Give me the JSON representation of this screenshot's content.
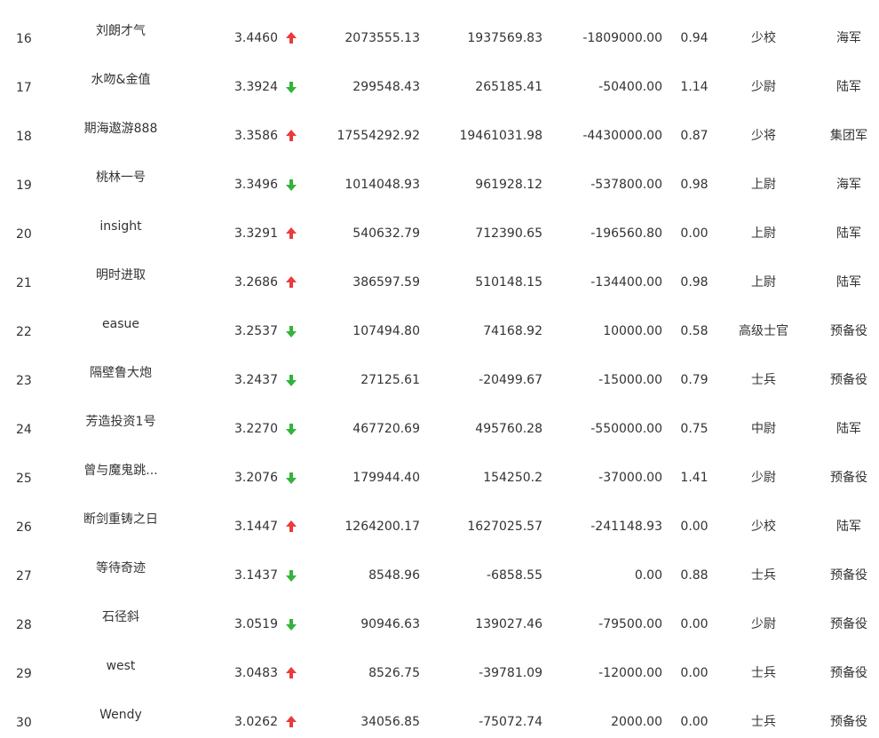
{
  "colors": {
    "up": "#ea3b3b",
    "down": "#33b33a",
    "text": "#333333"
  },
  "rows": [
    {
      "rank": "16",
      "name": "刘朗才气",
      "score": "3.4460",
      "trend": "up",
      "v1": "2073555.13",
      "v2": "1937569.83",
      "v3": "-1809000.00",
      "ratio": "0.94",
      "military_rank": "少校",
      "branch": "海军"
    },
    {
      "rank": "17",
      "name": "水吻&金值",
      "score": "3.3924",
      "trend": "down",
      "v1": "299548.43",
      "v2": "265185.41",
      "v3": "-50400.00",
      "ratio": "1.14",
      "military_rank": "少尉",
      "branch": "陆军"
    },
    {
      "rank": "18",
      "name": "期海遨游888",
      "score": "3.3586",
      "trend": "up",
      "v1": "17554292.92",
      "v2": "19461031.98",
      "v3": "-4430000.00",
      "ratio": "0.87",
      "military_rank": "少将",
      "branch": "集团军"
    },
    {
      "rank": "19",
      "name": "桃林一号",
      "score": "3.3496",
      "trend": "down",
      "v1": "1014048.93",
      "v2": "961928.12",
      "v3": "-537800.00",
      "ratio": "0.98",
      "military_rank": "上尉",
      "branch": "海军"
    },
    {
      "rank": "20",
      "name": "insight",
      "score": "3.3291",
      "trend": "up",
      "v1": "540632.79",
      "v2": "712390.65",
      "v3": "-196560.80",
      "ratio": "0.00",
      "military_rank": "上尉",
      "branch": "陆军"
    },
    {
      "rank": "21",
      "name": "明时进取",
      "score": "3.2686",
      "trend": "up",
      "v1": "386597.59",
      "v2": "510148.15",
      "v3": "-134400.00",
      "ratio": "0.98",
      "military_rank": "上尉",
      "branch": "陆军"
    },
    {
      "rank": "22",
      "name": "easue",
      "score": "3.2537",
      "trend": "down",
      "v1": "107494.80",
      "v2": "74168.92",
      "v3": "10000.00",
      "ratio": "0.58",
      "military_rank": "高级士官",
      "branch": "预备役"
    },
    {
      "rank": "23",
      "name": "隔壁鲁大炮",
      "score": "3.2437",
      "trend": "down",
      "v1": "27125.61",
      "v2": "-20499.67",
      "v3": "-15000.00",
      "ratio": "0.79",
      "military_rank": "士兵",
      "branch": "预备役"
    },
    {
      "rank": "24",
      "name": "芳造投资1号",
      "score": "3.2270",
      "trend": "down",
      "v1": "467720.69",
      "v2": "495760.28",
      "v3": "-550000.00",
      "ratio": "0.75",
      "military_rank": "中尉",
      "branch": "陆军"
    },
    {
      "rank": "25",
      "name": "曾与魔鬼跳...",
      "score": "3.2076",
      "trend": "down",
      "v1": "179944.40",
      "v2": "154250.2",
      "v3": "-37000.00",
      "ratio": "1.41",
      "military_rank": "少尉",
      "branch": "预备役"
    },
    {
      "rank": "26",
      "name": "断剑重铸之日",
      "score": "3.1447",
      "trend": "up",
      "v1": "1264200.17",
      "v2": "1627025.57",
      "v3": "-241148.93",
      "ratio": "0.00",
      "military_rank": "少校",
      "branch": "陆军"
    },
    {
      "rank": "27",
      "name": "等待奇迹",
      "score": "3.1437",
      "trend": "down",
      "v1": "8548.96",
      "v2": "-6858.55",
      "v3": "0.00",
      "ratio": "0.88",
      "military_rank": "士兵",
      "branch": "预备役"
    },
    {
      "rank": "28",
      "name": "石径斜",
      "score": "3.0519",
      "trend": "down",
      "v1": "90946.63",
      "v2": "139027.46",
      "v3": "-79500.00",
      "ratio": "0.00",
      "military_rank": "少尉",
      "branch": "预备役"
    },
    {
      "rank": "29",
      "name": "west",
      "score": "3.0483",
      "trend": "up",
      "v1": "8526.75",
      "v2": "-39781.09",
      "v3": "-12000.00",
      "ratio": "0.00",
      "military_rank": "士兵",
      "branch": "预备役"
    },
    {
      "rank": "30",
      "name": "Wendy",
      "score": "3.0262",
      "trend": "up",
      "v1": "34056.85",
      "v2": "-75072.74",
      "v3": "2000.00",
      "ratio": "0.00",
      "military_rank": "士兵",
      "branch": "预备役"
    }
  ]
}
